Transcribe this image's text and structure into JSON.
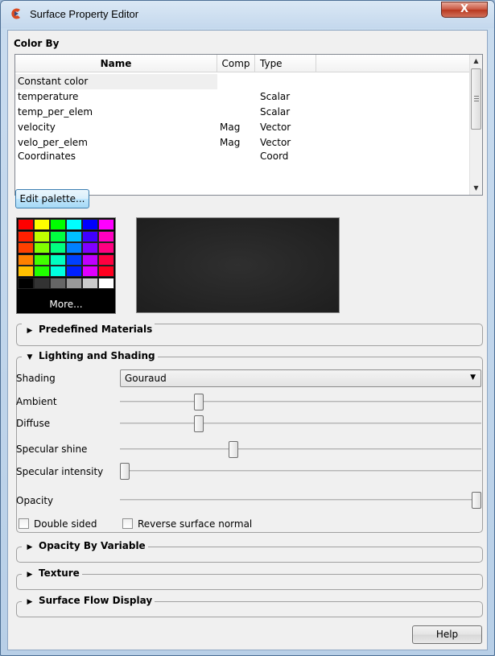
{
  "window": {
    "title": "Surface Property Editor",
    "close_label": "X"
  },
  "color_by": {
    "title": "Color By",
    "columns": [
      "Name",
      "Comp",
      "Type"
    ],
    "rows": [
      {
        "name": "Constant color",
        "comp": "",
        "type": ""
      },
      {
        "name": "temperature",
        "comp": "",
        "type": "Scalar"
      },
      {
        "name": "temp_per_elem",
        "comp": "",
        "type": "Scalar"
      },
      {
        "name": "velocity",
        "comp": "Mag",
        "type": "Vector"
      },
      {
        "name": "velo_per_elem",
        "comp": "Mag",
        "type": "Vector"
      },
      {
        "name": "Coordinates",
        "comp": "",
        "type": "Coord"
      }
    ]
  },
  "edit_palette_label": "Edit palette...",
  "palette": {
    "more_label": "More...",
    "colors": [
      [
        "#ff0000",
        "#ffff00",
        "#00ff00",
        "#00ffff",
        "#0000ff",
        "#ff00ff"
      ],
      [
        "#ff2000",
        "#c0ff00",
        "#00ff40",
        "#00c0ff",
        "#4000ff",
        "#ff00c0"
      ],
      [
        "#ff4000",
        "#80ff00",
        "#00ff80",
        "#0080ff",
        "#8000ff",
        "#ff0080"
      ],
      [
        "#ff8000",
        "#40ff00",
        "#00ffc0",
        "#0040ff",
        "#c000ff",
        "#ff0040"
      ],
      [
        "#ffc000",
        "#20ff00",
        "#00ffe0",
        "#0020ff",
        "#e000ff",
        "#ff0020"
      ],
      [
        "#000000",
        "#333333",
        "#666666",
        "#999999",
        "#cccccc",
        "#ffffff"
      ]
    ]
  },
  "sections": {
    "predefined": "Predefined Materials",
    "lighting": "Lighting and Shading",
    "opacity_by_var": "Opacity By Variable",
    "texture": "Texture",
    "surface_flow": "Surface Flow Display"
  },
  "lighting": {
    "shading_label": "Shading",
    "shading_value": "Gouraud",
    "ambient_label": "Ambient",
    "diffuse_label": "Diffuse",
    "specular_shine_label": "Specular shine",
    "specular_intensity_label": "Specular intensity",
    "opacity_label": "Opacity",
    "double_sided_label": "Double sided",
    "reverse_normal_label": "Reverse surface normal",
    "sliders": {
      "ambient": 0.21,
      "diffuse": 0.21,
      "specular_shine": 0.31,
      "specular_intensity": 0.0,
      "opacity": 1.0
    },
    "double_sided": false,
    "reverse_normal": false
  },
  "help_label": "Help",
  "colors": {
    "accent": "#3c7fb1",
    "title_bg": "#c4d8ed",
    "preview_bg": "#222222"
  }
}
